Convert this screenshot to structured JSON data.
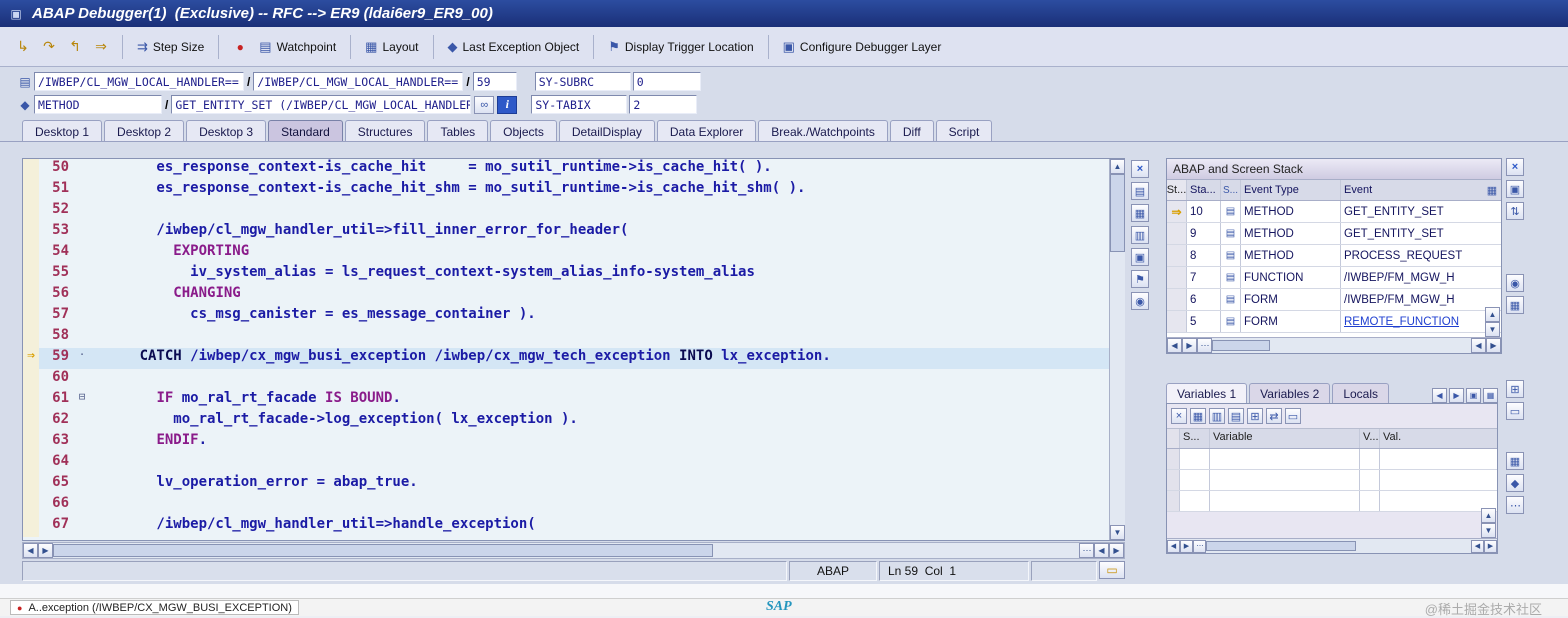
{
  "window": {
    "title": "ABAP Debugger(1)  (Exclusive) -- RFC --> ER9 (ldai6er9_ER9_00)"
  },
  "icons": {
    "window": "▣",
    "step_into": "↳",
    "step_over": "↷",
    "step_return": "↰",
    "continue": "⇒",
    "step_size": "⇉",
    "watchpoint_led": "●",
    "page": "▤",
    "layout": "▦",
    "exception_object": "◆",
    "trigger_location": "⚑",
    "debugger_layer": "▣",
    "source": "▤",
    "event": "◆",
    "glasses": "∞",
    "info": "i",
    "close": "×",
    "grid": "▦",
    "rows": "▥",
    "columns": "▤",
    "copy": "▣",
    "updown": "⇅",
    "target": "◉",
    "up": "▲",
    "down": "▼",
    "left": "◀",
    "right": "▶",
    "grip": "⋯",
    "current_arrow": "⇒",
    "delete": "×",
    "add": "⊞",
    "swap": "⇄",
    "note": "▭",
    "fold_open": "⊟"
  },
  "toolbar": {
    "items": [
      {
        "label": "Step Size"
      },
      {
        "label": "Watchpoint"
      },
      {
        "label": "Layout"
      },
      {
        "label": "Last Exception Object"
      },
      {
        "label": "Display Trigger Location"
      },
      {
        "label": "Configure Debugger Layer"
      }
    ]
  },
  "context": {
    "row1": {
      "main": "/IWBEP/CL_MGW_LOCAL_HANDLER==",
      "sep": "/",
      "include": "/IWBEP/CL_MGW_LOCAL_HANDLER==",
      "line": "59",
      "sys_label": "SY-SUBRC",
      "sys_value": "0"
    },
    "row2": {
      "event_type": "METHOD",
      "sep": "/",
      "event": "GET_ENTITY_SET (/IWBEP/CL_MGW_LOCAL_HANDLER)",
      "sys_label": "SY-TABIX",
      "sys_value": "2"
    }
  },
  "tabs": {
    "items": [
      "Desktop 1",
      "Desktop 2",
      "Desktop 3",
      "Standard",
      "Structures",
      "Tables",
      "Objects",
      "DetailDisplay",
      "Data Explorer",
      "Break./Watchpoints",
      "Diff",
      "Script"
    ],
    "active": "Standard"
  },
  "editor": {
    "lines": [
      {
        "no": "50",
        "seg": [
          {
            "c": "code",
            "t": "        es_response_context-is_cache_hit     = mo_sutil_runtime->is_cache_hit( )."
          }
        ]
      },
      {
        "no": "51",
        "seg": [
          {
            "c": "code",
            "t": "        es_response_context-is_cache_hit_shm = mo_sutil_runtime->is_cache_hit_shm( )."
          }
        ]
      },
      {
        "no": "52",
        "seg": []
      },
      {
        "no": "53",
        "seg": [
          {
            "c": "code",
            "t": "        /iwbep/cl_mgw_handler_util=>fill_inner_error_for_header("
          }
        ]
      },
      {
        "no": "54",
        "seg": [
          {
            "c": "code",
            "t": "          "
          },
          {
            "c": "kw",
            "t": "EXPORTING"
          }
        ]
      },
      {
        "no": "55",
        "seg": [
          {
            "c": "code",
            "t": "            iv_system_alias = ls_request_context-system_alias_info-system_alias"
          }
        ]
      },
      {
        "no": "56",
        "seg": [
          {
            "c": "code",
            "t": "          "
          },
          {
            "c": "kw",
            "t": "CHANGING"
          }
        ]
      },
      {
        "no": "57",
        "seg": [
          {
            "c": "code",
            "t": "            cs_msg_canister = es_message_container )."
          }
        ]
      },
      {
        "no": "58",
        "seg": []
      },
      {
        "no": "59",
        "current": true,
        "fold": "·",
        "seg": [
          {
            "c": "code",
            "t": "      "
          },
          {
            "c": "kw2",
            "t": "CATCH"
          },
          {
            "c": "code",
            "t": " /iwbep/cx_mgw_busi_exception /iwbep/cx_mgw_tech_exception "
          },
          {
            "c": "kw2",
            "t": "INTO"
          },
          {
            "c": "code",
            "t": " lx_exception."
          }
        ]
      },
      {
        "no": "60",
        "seg": []
      },
      {
        "no": "61",
        "fold": "⊟",
        "seg": [
          {
            "c": "code",
            "t": "        "
          },
          {
            "c": "kw",
            "t": "IF"
          },
          {
            "c": "code",
            "t": " mo_ral_rt_facade "
          },
          {
            "c": "kw",
            "t": "IS BOUND"
          },
          {
            "c": "code",
            "t": "."
          }
        ]
      },
      {
        "no": "62",
        "seg": [
          {
            "c": "code",
            "t": "          mo_ral_rt_facade->log_exception( lx_exception )."
          }
        ]
      },
      {
        "no": "63",
        "seg": [
          {
            "c": "code",
            "t": "        "
          },
          {
            "c": "kw",
            "t": "ENDIF"
          },
          {
            "c": "code",
            "t": "."
          }
        ]
      },
      {
        "no": "64",
        "seg": []
      },
      {
        "no": "65",
        "seg": [
          {
            "c": "code",
            "t": "        lv_operation_error = abap_true."
          }
        ]
      },
      {
        "no": "66",
        "seg": []
      },
      {
        "no": "67",
        "seg": [
          {
            "c": "code",
            "t": "        /iwbep/cl_mgw_handler_util=>handle_exception("
          }
        ]
      }
    ],
    "status": {
      "lang": "ABAP",
      "position": "Ln 59  Col  1"
    }
  },
  "stack": {
    "title": "ABAP and Screen Stack",
    "columns": [
      "St...",
      "Sta...",
      "S...",
      "Event Type",
      "Event"
    ],
    "rows": [
      {
        "current": true,
        "level": "10",
        "type": "METHOD",
        "event": "GET_ENTITY_SET"
      },
      {
        "level": "9",
        "type": "METHOD",
        "event": "GET_ENTITY_SET"
      },
      {
        "level": "8",
        "type": "METHOD",
        "event": "PROCESS_REQUEST"
      },
      {
        "level": "7",
        "type": "FUNCTION",
        "event": "/IWBEP/FM_MGW_H"
      },
      {
        "level": "6",
        "type": "FORM",
        "event": "/IWBEP/FM_MGW_H"
      },
      {
        "level": "5",
        "type": "FORM",
        "event": "REMOTE_FUNCTION",
        "link": true
      }
    ]
  },
  "variables": {
    "tabs": [
      "Variables 1",
      "Variables 2",
      "Locals"
    ],
    "active": "Variables 1",
    "columns": [
      "S...",
      "Variable",
      "V...",
      "Val."
    ],
    "rows": [
      {},
      {},
      {}
    ]
  },
  "taskbar": {
    "button_label": "A..exception (/IWBEP/CX_MGW_BUSI_EXCEPTION)",
    "sap_logo": "SAP",
    "watermark": "@稀土掘金技术社区"
  }
}
